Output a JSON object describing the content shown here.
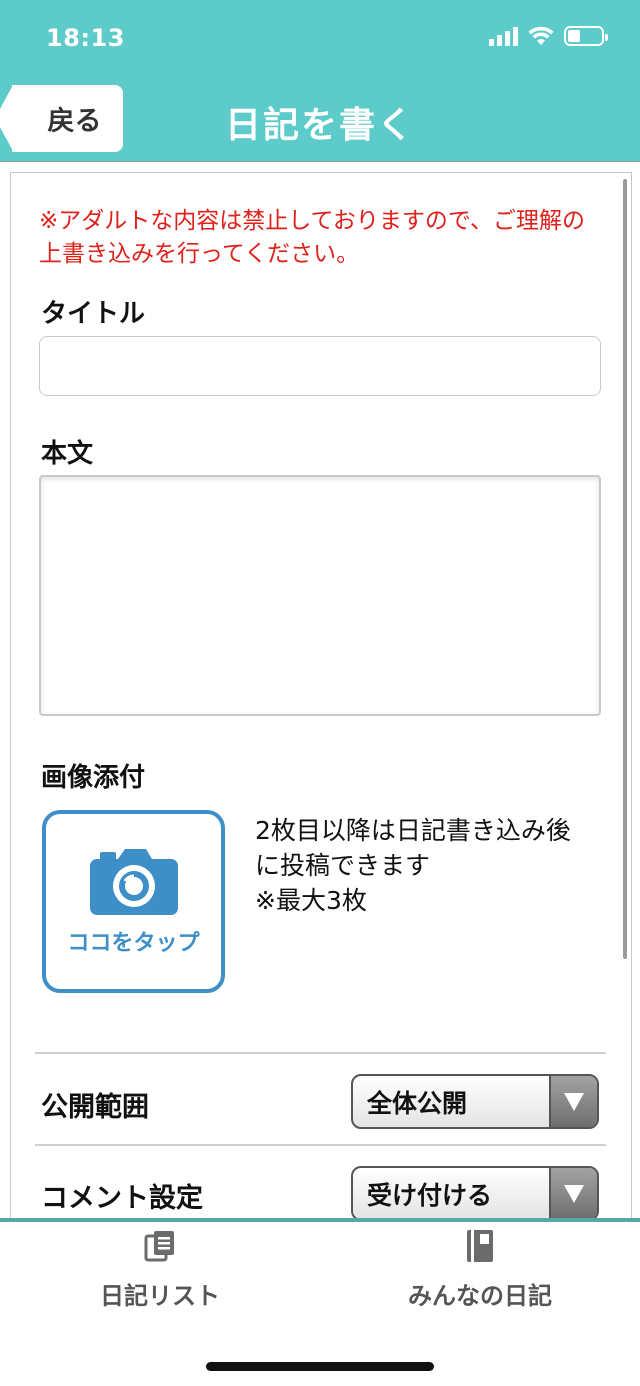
{
  "status_bar": {
    "time": "18:13"
  },
  "header": {
    "back_label": "戻る",
    "title": "日記を書く",
    "color": "#5ecbcb"
  },
  "form": {
    "warning": "※アダルトな内容は禁止しておりますので、ご理解の上書き込みを行ってください。",
    "title_label": "タイトル",
    "title_value": "",
    "body_label": "本文",
    "body_value": "",
    "image_label": "画像添付",
    "camera_button_label": "ココをタップ",
    "attach_note_line1": "2枚目以降は日記書き込み後に投稿できます",
    "attach_note_line2": "※最大3枚"
  },
  "settings": {
    "visibility_label": "公開範囲",
    "visibility_value": "全体公開",
    "comment_label": "コメント設定",
    "comment_value": "受け付ける"
  },
  "tabbar": {
    "tabs": [
      {
        "label": "日記リスト",
        "icon": "documents-icon"
      },
      {
        "label": "みんなの日記",
        "icon": "notebook-icon"
      }
    ]
  },
  "colors": {
    "accent": "#5ecbcb",
    "warning": "#e0211b",
    "camera_blue": "#3e8ec8"
  }
}
